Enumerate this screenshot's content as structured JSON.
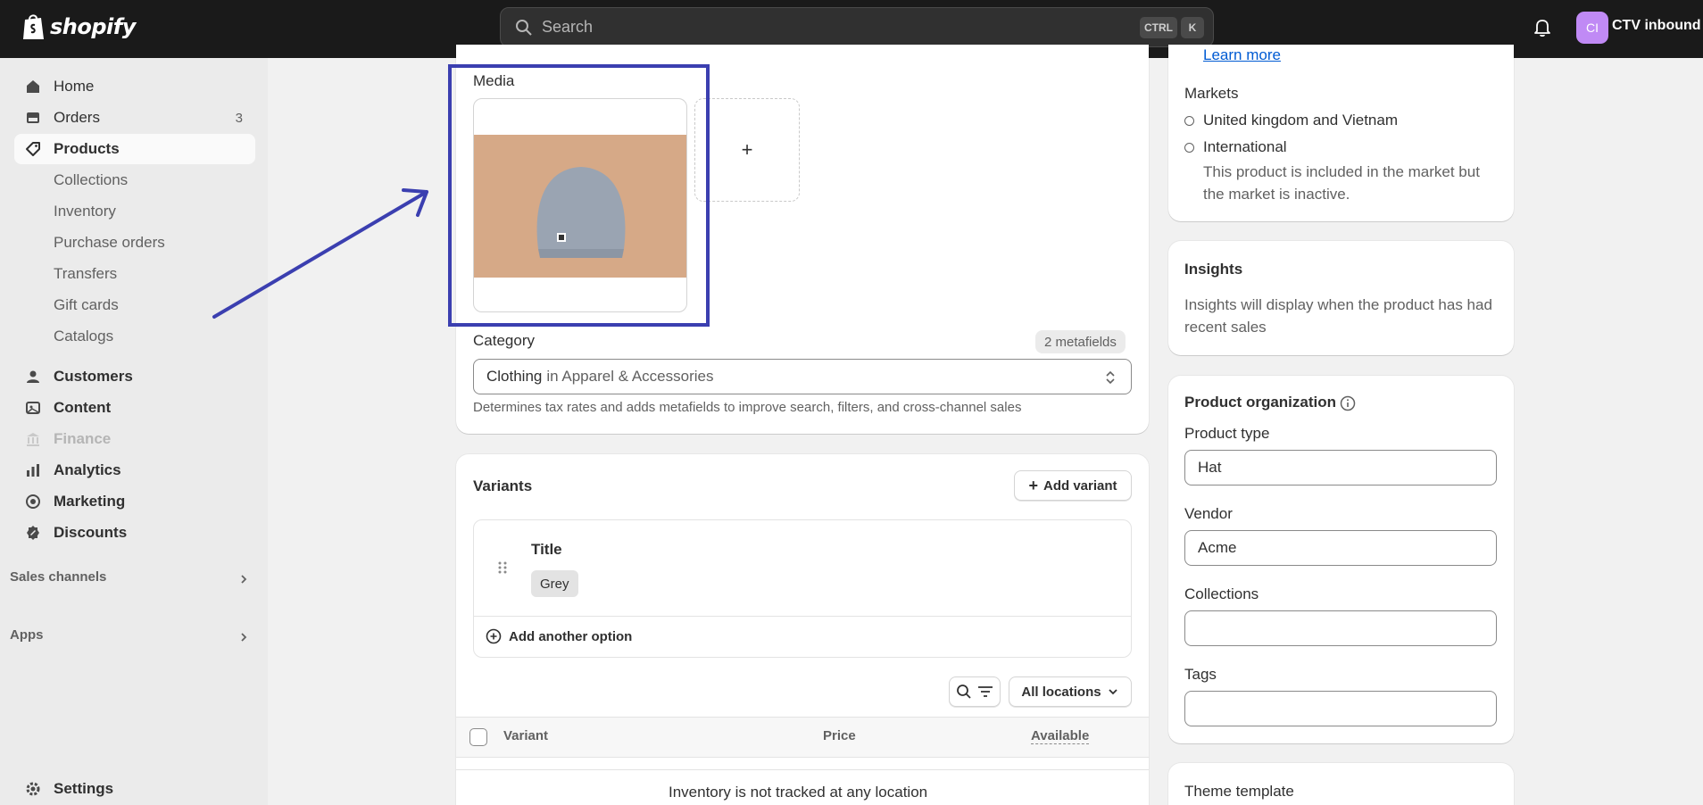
{
  "topbar": {
    "logo_text": "shopify",
    "search_placeholder": "Search",
    "shortcut_ctrl": "CTRL",
    "shortcut_k": "K",
    "avatar_initials": "CI",
    "store_name": "CTV inbound"
  },
  "sidebar": {
    "items": [
      {
        "label": "Home",
        "icon": "home-icon"
      },
      {
        "label": "Orders",
        "icon": "orders-icon",
        "badge": "3"
      },
      {
        "label": "Products",
        "icon": "tag-icon"
      },
      {
        "label": "Collections"
      },
      {
        "label": "Inventory"
      },
      {
        "label": "Purchase orders"
      },
      {
        "label": "Transfers"
      },
      {
        "label": "Gift cards"
      },
      {
        "label": "Catalogs"
      },
      {
        "label": "Customers",
        "icon": "person-icon"
      },
      {
        "label": "Content",
        "icon": "content-icon"
      },
      {
        "label": "Finance",
        "icon": "bank-icon"
      },
      {
        "label": "Analytics",
        "icon": "chart-icon"
      },
      {
        "label": "Marketing",
        "icon": "target-icon"
      },
      {
        "label": "Discounts",
        "icon": "discount-icon"
      }
    ],
    "sales_channels_label": "Sales channels",
    "apps_label": "Apps",
    "settings_label": "Settings"
  },
  "media": {
    "label": "Media",
    "add_symbol": "+"
  },
  "category": {
    "label": "Category",
    "metafields_badge": "2 metafields",
    "value_main": "Clothing",
    "value_context": "in Apparel & Accessories",
    "help_text": "Determines tax rates and adds metafields to improve search, filters, and cross-channel sales"
  },
  "variants": {
    "title": "Variants",
    "add_variant_label": "Add variant",
    "option_name": "Title",
    "option_value": "Grey",
    "add_option_label": "Add another option",
    "locations_label": "All locations",
    "columns": [
      "Variant",
      "Price",
      "Available"
    ],
    "inventory_note": "Inventory is not tracked at any location"
  },
  "right": {
    "learn_more": "Learn more",
    "markets_title": "Markets",
    "markets": [
      "United kingdom and Vietnam",
      "International"
    ],
    "market_note": "This product is included in the market but the market is inactive.",
    "insights_title": "Insights",
    "insights_text": "Insights will display when the product has had recent sales",
    "org_title": "Product organization",
    "product_type_label": "Product type",
    "product_type_value": "Hat",
    "vendor_label": "Vendor",
    "vendor_value": "Acme",
    "collections_label": "Collections",
    "collections_value": "",
    "tags_label": "Tags",
    "tags_value": "",
    "theme_template_label": "Theme template"
  },
  "colors": {
    "topbar": "#1a1a1a",
    "annotation": "#3b3fb0",
    "link": "#005bd3",
    "avatar": "#c08af5"
  }
}
